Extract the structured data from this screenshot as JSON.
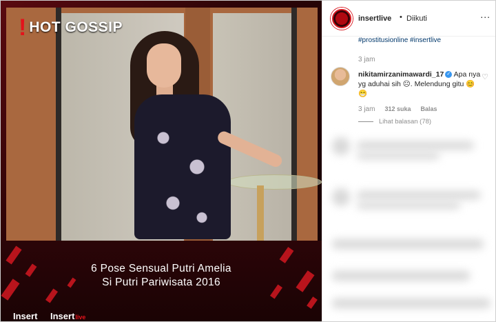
{
  "post": {
    "badge_text": "HOT GOSSIP",
    "caption_line1": "6 Pose Sensual Putri Amelia",
    "caption_line2": "Si Putri Pariwisata 2016",
    "logo_left": "Insert",
    "logo_right": "Insert",
    "logo_right_suffix": "live"
  },
  "header": {
    "username": "insertlive",
    "separator": "•",
    "follow_status": "Diikuti",
    "more": "..."
  },
  "caption_tail": {
    "hashtags": "#prostitusionline #insertlive",
    "time": "3 jam"
  },
  "comment": {
    "username": "nikitamirzanimawardi_17",
    "verified": "✓",
    "text_lead": "Apa",
    "text_rest": "nya yg aduhai sih ☹. Melendung gitu 😊😁",
    "time": "3 jam",
    "likes": "312 suka",
    "reply": "Balas",
    "view_replies": "Lihat balasan (78)"
  },
  "colors": {
    "accent_red": "#e3131b",
    "link": "#00376b",
    "muted": "#8e8e8e"
  }
}
